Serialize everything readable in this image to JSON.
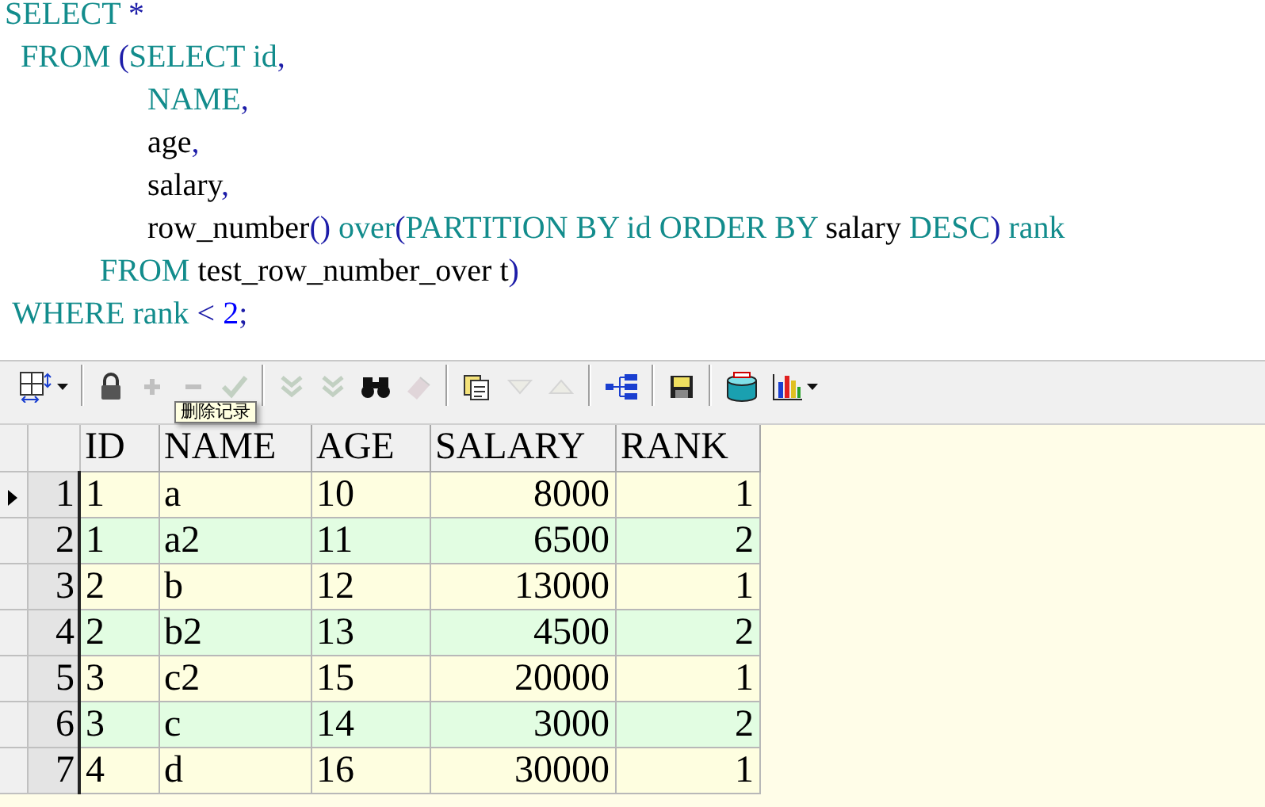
{
  "sql_editor": {
    "lines": [
      {
        "tokens": [
          {
            "kind": "keyword",
            "text": "SELECT"
          },
          {
            "kind": "punct",
            "text": " *"
          }
        ]
      },
      {
        "tokens": [
          {
            "kind": "keyword",
            "text": "  FROM "
          },
          {
            "kind": "punct",
            "text": "("
          },
          {
            "kind": "keyword",
            "text": "SELECT id"
          },
          {
            "kind": "punct",
            "text": ","
          }
        ]
      },
      {
        "tokens": [
          {
            "kind": "keyword",
            "text": "                  NAME"
          },
          {
            "kind": "punct",
            "text": ","
          }
        ]
      },
      {
        "tokens": [
          {
            "kind": "ident",
            "text": "                  age"
          },
          {
            "kind": "punct",
            "text": ","
          }
        ]
      },
      {
        "tokens": [
          {
            "kind": "ident",
            "text": "                  salary"
          },
          {
            "kind": "punct",
            "text": ","
          }
        ]
      },
      {
        "tokens": [
          {
            "kind": "ident",
            "text": "                  row_number"
          },
          {
            "kind": "punct",
            "text": "()"
          },
          {
            "kind": "keyword",
            "text": " over"
          },
          {
            "kind": "punct",
            "text": "("
          },
          {
            "kind": "keyword",
            "text": "PARTITION BY id ORDER BY "
          },
          {
            "kind": "ident",
            "text": "salary"
          },
          {
            "kind": "keyword",
            "text": " DESC"
          },
          {
            "kind": "punct",
            "text": ")"
          },
          {
            "kind": "keyword",
            "text": " rank"
          }
        ]
      },
      {
        "tokens": [
          {
            "kind": "keyword",
            "text": "            FROM "
          },
          {
            "kind": "ident",
            "text": "test_row_number_over t"
          },
          {
            "kind": "punct",
            "text": ")"
          }
        ]
      },
      {
        "tokens": [
          {
            "kind": "keyword",
            "text": " WHERE rank "
          },
          {
            "kind": "punct",
            "text": "< "
          },
          {
            "kind": "number",
            "text": "2"
          },
          {
            "kind": "punct",
            "text": ";"
          }
        ]
      }
    ]
  },
  "toolbar": [
    {
      "kind": "grid",
      "disabled": false,
      "dropdown": true
    },
    {
      "kind": "separator"
    },
    {
      "kind": "lock",
      "disabled": false
    },
    {
      "kind": "plus",
      "disabled": true
    },
    {
      "kind": "minus",
      "disabled": true
    },
    {
      "kind": "check",
      "disabled": true
    },
    {
      "kind": "separator"
    },
    {
      "kind": "chevrons",
      "disabled": true
    },
    {
      "kind": "chevrons",
      "disabled": true
    },
    {
      "kind": "binoculars",
      "disabled": false
    },
    {
      "kind": "eraser",
      "disabled": true
    },
    {
      "kind": "separator"
    },
    {
      "kind": "document",
      "disabled": false
    },
    {
      "kind": "triangle-down",
      "disabled": true
    },
    {
      "kind": "triangle-up",
      "disabled": true
    },
    {
      "kind": "separator"
    },
    {
      "kind": "tree",
      "disabled": false
    },
    {
      "kind": "separator"
    },
    {
      "kind": "floppy",
      "disabled": false
    },
    {
      "kind": "separator"
    },
    {
      "kind": "database",
      "disabled": false
    },
    {
      "kind": "bar-chart",
      "disabled": false,
      "dropdown": true
    }
  ],
  "tooltip": "删除记录",
  "table": {
    "columns": [
      "ID",
      "NAME",
      "AGE",
      "SALARY",
      "RANK"
    ],
    "rows": [
      {
        "number": "1",
        "current": true,
        "cells": [
          "1",
          "a",
          "10",
          "8000",
          "1"
        ]
      },
      {
        "number": "2",
        "current": false,
        "cells": [
          "1",
          "a2",
          "11",
          "6500",
          "2"
        ]
      },
      {
        "number": "3",
        "current": false,
        "cells": [
          "2",
          "b",
          "12",
          "13000",
          "1"
        ]
      },
      {
        "number": "4",
        "current": false,
        "cells": [
          "2",
          "b2",
          "13",
          "4500",
          "2"
        ]
      },
      {
        "number": "5",
        "current": false,
        "cells": [
          "3",
          "c2",
          "15",
          "20000",
          "1"
        ]
      },
      {
        "number": "6",
        "current": false,
        "cells": [
          "3",
          "c",
          "14",
          "3000",
          "2"
        ]
      },
      {
        "number": "7",
        "current": false,
        "cells": [
          "4",
          "d",
          "16",
          "30000",
          "1"
        ]
      }
    ]
  }
}
